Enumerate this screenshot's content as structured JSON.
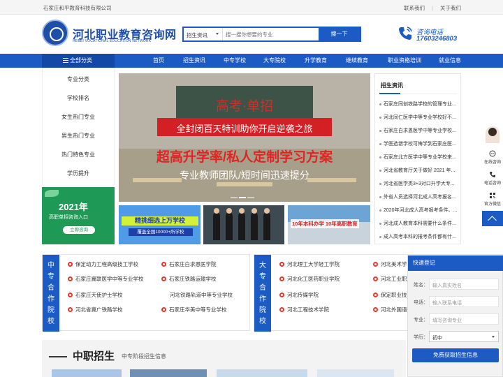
{
  "topbar": {
    "company": "石家庄和平教育科技有限公司",
    "links": [
      "联系我们",
      "关于我们"
    ]
  },
  "header": {
    "logo_title": "河北职业教育咨询网",
    "logo_sub": "HEBEI VOCATIONAL EDUCATION NETWORK",
    "search_category": "招生资讯",
    "search_placeholder": "搜一搜你想要的专业",
    "search_button": "搜一下",
    "phone_label": "咨询电话",
    "phone_number": "17603246803"
  },
  "nav": {
    "all_categories": "全部分类",
    "items": [
      "首页",
      "招生资讯",
      "中专学校",
      "大专院校",
      "升学教育",
      "继续教育",
      "职业资格培训",
      "就业信息"
    ]
  },
  "categories": [
    "专业分类",
    "学校排名",
    "女生热门专业",
    "男生热门专业",
    "热门特色专业",
    "学历提升"
  ],
  "promo": {
    "year": "2021年",
    "text": "高职单招咨询入口",
    "button": "立即咨询"
  },
  "banner": {
    "line1": "高考·单招",
    "line2": "全封闭百天特训助你开启逆袭之旅",
    "line3": "超高升学率/私人定制学习方案",
    "line4": "专业教师团队/短时间迅速提分"
  },
  "thumbs": {
    "t1_title": "精挑细选上万学校",
    "t1_sub": "覆盖全国10000+所学校",
    "t3_title": "10年本科办学 10年高职教育"
  },
  "news": {
    "title": "招生资讯",
    "items": [
      "石家庄同创铁路学校的管理专业...",
      "河北同仁医学中等专业学校好不...",
      "石家庄白求恩医学中等专业学校...",
      "学医选错学校可悔学到石家庄医...",
      "石家庄北方医学中等专业学校来...",
      "河北省教育厅关于做好 2021 年...",
      "河北省医学类3+3对口升学大专...",
      "外省人员选择河北成人高考报名...",
      "2020年河北成人高考报考条件、...",
      "河北成人教育本科需要什么条件...",
      "成人高考本科的报考条件都有什..."
    ]
  },
  "coop_secondary": {
    "tag": [
      "中",
      "专",
      "合",
      "作",
      "院",
      "校"
    ],
    "schools": [
      "保定动力工程高级技工学校",
      "石家庄白求恩医学院",
      "石家庄冀联医学中等专业学校",
      "石家庄铁路运输学校",
      "石家庄天使护士学校",
      "河北铁路轨道中等专业学校",
      "河北省冀广铁路学校",
      "石家庄华美中等专业学校"
    ]
  },
  "coop_college": {
    "tag": [
      "大",
      "专",
      "合",
      "作",
      "院",
      "校"
    ],
    "schools": [
      "河北理工大学轻工学院",
      "河北美术学",
      "河北化工医药职业学院",
      "河北工业职",
      "河北传媒学院",
      "保定职业技",
      "河北工程技术学院",
      "河北外国语"
    ]
  },
  "register": {
    "title": "快速登记",
    "name_label": "姓名：",
    "name_placeholder": "输入真实姓名",
    "phone_label": "电话：",
    "phone_placeholder": "输入联系电话",
    "major_label": "专业：",
    "major_placeholder": "填写咨询专业",
    "edu_label": "学历：",
    "edu_value": "初中",
    "submit": "免费获取招生信息"
  },
  "side": {
    "items": [
      "在线咨询",
      "电话咨询",
      "官方微信"
    ]
  },
  "section": {
    "title": "中职招生",
    "subtitle": "中专阶段招生信息"
  },
  "colors": {
    "primary": "#1d5bc4",
    "dark_primary": "#1448a6",
    "accent_red": "#d41f24",
    "promo_green": "#1f9a56"
  }
}
